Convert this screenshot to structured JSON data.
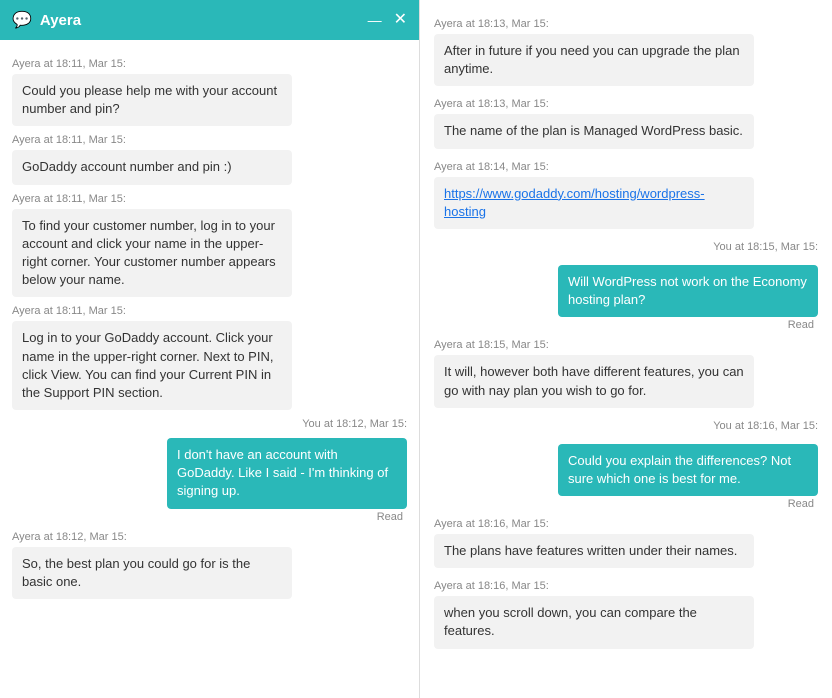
{
  "header": {
    "title": "Ayera",
    "icon": "💬",
    "minimize_label": "—",
    "close_label": "✕"
  },
  "left_messages": [
    {
      "type": "timestamp",
      "text": "Ayera at 18:11, Mar 15:"
    },
    {
      "type": "agent",
      "text": "Could you please help me with your account number and pin?"
    },
    {
      "type": "timestamp",
      "text": "Ayera at 18:11, Mar 15:"
    },
    {
      "type": "agent",
      "text": "GoDaddy account number and pin :)"
    },
    {
      "type": "timestamp",
      "text": "Ayera at 18:11, Mar 15:"
    },
    {
      "type": "agent",
      "text": "To find your customer number, log in to your account and click your name in the upper-right corner. Your customer number appears below your name."
    },
    {
      "type": "timestamp",
      "text": "Ayera at 18:11, Mar 15:"
    },
    {
      "type": "agent",
      "text": "Log in to your GoDaddy account. Click your name in the upper-right corner. Next to PIN, click View. You can find your Current PIN in the Support PIN section."
    },
    {
      "type": "timestamp_right",
      "text": "You at 18:12, Mar 15:"
    },
    {
      "type": "user",
      "text": "I don't have an account with GoDaddy. Like I said - I'm thinking of signing up.",
      "read": "Read"
    },
    {
      "type": "timestamp",
      "text": "Ayera at 18:12, Mar 15:"
    },
    {
      "type": "agent",
      "text": "So, the best plan you could go for is the basic one."
    }
  ],
  "right_messages": [
    {
      "type": "timestamp",
      "text": "Ayera at 18:13, Mar 15:"
    },
    {
      "type": "agent",
      "text": "After in future if you need you can upgrade the plan anytime."
    },
    {
      "type": "timestamp",
      "text": "Ayera at 18:13, Mar 15:"
    },
    {
      "type": "agent",
      "text": "The name of the plan is Managed WordPress basic."
    },
    {
      "type": "timestamp",
      "text": "Ayera at 18:14, Mar 15:"
    },
    {
      "type": "link",
      "text": "https://www.godaddy.com/hosting/wordpress-hosting"
    },
    {
      "type": "timestamp_right",
      "text": "You at 18:15, Mar 15:"
    },
    {
      "type": "user",
      "text": "Will WordPress not work on the Economy hosting plan?",
      "read": "Read"
    },
    {
      "type": "timestamp",
      "text": "Ayera at 18:15, Mar 15:"
    },
    {
      "type": "agent",
      "text": "It will, however both have different features, you can go with nay plan you wish to go for."
    },
    {
      "type": "timestamp_right",
      "text": "You at 18:16, Mar 15:"
    },
    {
      "type": "user",
      "text": "Could you explain the differences? Not sure which one is best for me.",
      "read": "Read"
    },
    {
      "type": "timestamp",
      "text": "Ayera at 18:16, Mar 15:"
    },
    {
      "type": "agent",
      "text": "The plans have features written under their names."
    },
    {
      "type": "timestamp",
      "text": "Ayera at 18:16, Mar 15:"
    },
    {
      "type": "agent",
      "text": "when you scroll down, you can compare the features."
    }
  ]
}
